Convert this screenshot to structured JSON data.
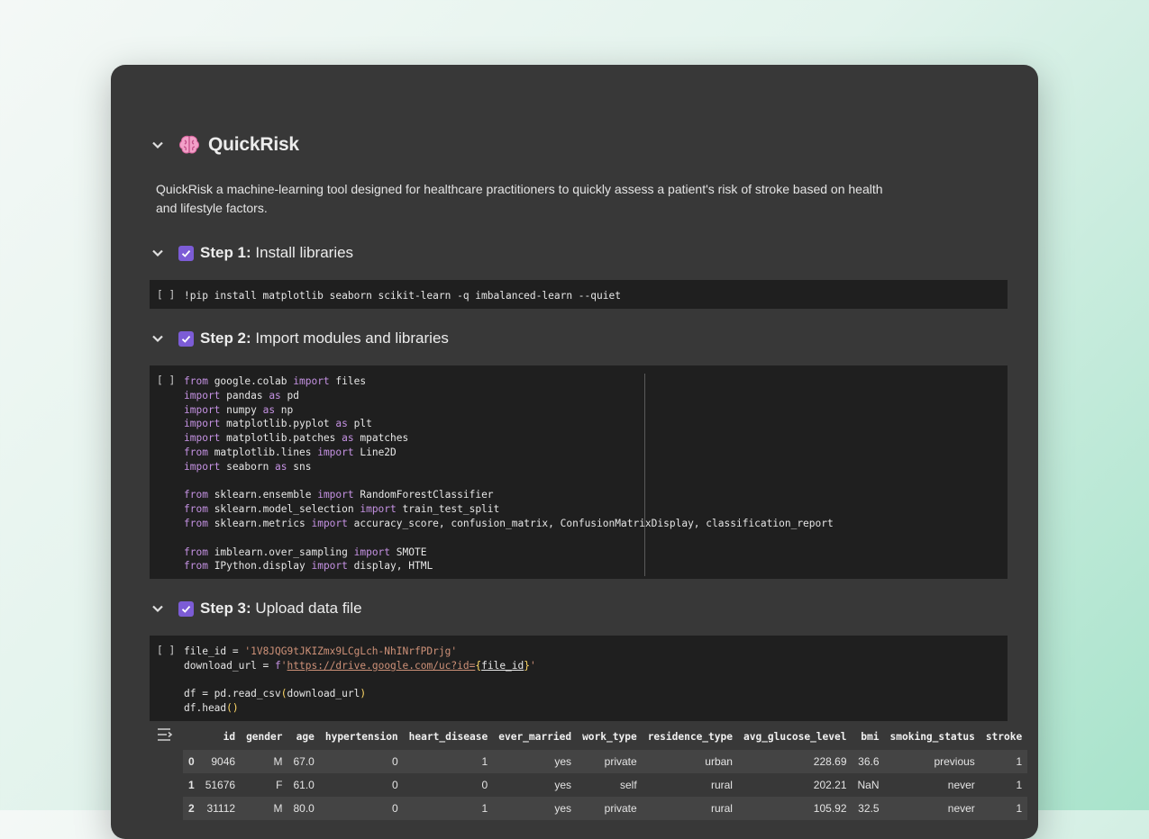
{
  "notebook": {
    "title": "QuickRisk",
    "description": "QuickRisk a machine-learning tool designed for healthcare practitioners to quickly assess a patient's risk of stroke based on health and lifestyle factors."
  },
  "steps": [
    {
      "bold": "Step 1:",
      "text": " Install libraries"
    },
    {
      "bold": "Step 2:",
      "text": " Import modules and libraries"
    },
    {
      "bold": "Step 3:",
      "text": " Upload data file"
    }
  ],
  "run_button_label": "[ ]",
  "cells": {
    "install": "!pip install matplotlib seaborn scikit-learn -q imbalanced-learn --quiet",
    "upload": {
      "file_id_value": "'1V8JQG9tJKIZmx9LCgLch-NhINrfPDrjg'",
      "url": "https://drive.google.com/uc?id=",
      "url_var": "{file_id}"
    }
  },
  "dataframe": {
    "columns": [
      "",
      "id",
      "gender",
      "age",
      "hypertension",
      "heart_disease",
      "ever_married",
      "work_type",
      "residence_type",
      "avg_glucose_level",
      "bmi",
      "smoking_status",
      "stroke"
    ],
    "rows": [
      [
        "0",
        "9046",
        "M",
        "67.0",
        "0",
        "1",
        "yes",
        "private",
        "urban",
        "228.69",
        "36.6",
        "previous",
        "1"
      ],
      [
        "1",
        "51676",
        "F",
        "61.0",
        "0",
        "0",
        "yes",
        "self",
        "rural",
        "202.21",
        "NaN",
        "never",
        "1"
      ],
      [
        "2",
        "31112",
        "M",
        "80.0",
        "0",
        "1",
        "yes",
        "private",
        "rural",
        "105.92",
        "32.5",
        "never",
        "1"
      ]
    ]
  },
  "colors": {
    "background": "#383838",
    "code_cell": "#1f1f1f",
    "checkbox": "#7c5cd6",
    "keyword": "#c592e3",
    "string": "#ce9178"
  },
  "icons": [
    "chevron-down-icon",
    "brain-emoji-icon",
    "checkbox-checked-icon",
    "output-toggle-icon"
  ]
}
